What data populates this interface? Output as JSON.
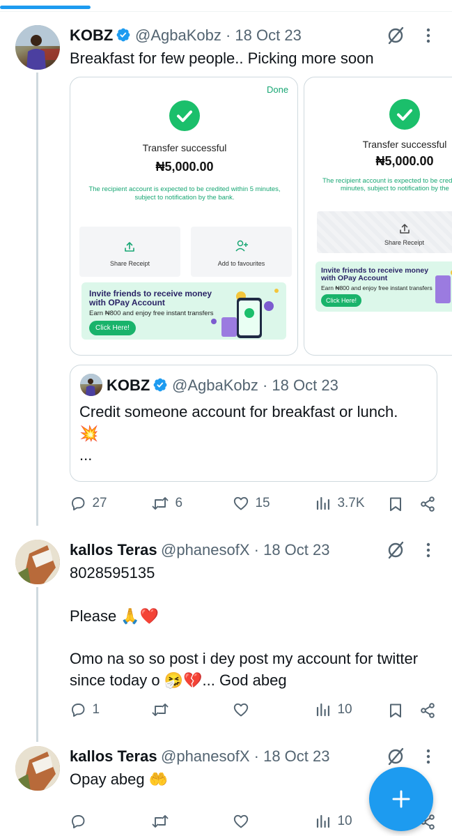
{
  "progress": {
    "fraction": 0.2
  },
  "tweet1": {
    "name": "KOBZ",
    "handle": "@AgbaKobz",
    "date": "· 18 Oct 23",
    "text": "Breakfast for few people.. Picking more soon",
    "receipt1": {
      "done_label": "Done",
      "status": "Transfer successful",
      "amount": "₦5,000.00",
      "note_line1": "The recipient account is expected to be credited within 5 minutes,",
      "note_line2": "subject to notification by the bank.",
      "share_label": "Share Receipt",
      "favourites_label": "Add to favourites",
      "promo_title_line1": "Invite friends to receive money",
      "promo_title_line2": "with OPay Account",
      "promo_sub": "Earn ₦800 and enjoy free instant transfers",
      "promo_button": "Click Here!"
    },
    "receipt2": {
      "status": "Transfer successful",
      "amount": "₦5,000.00",
      "note_line1": "The recipient account is expected to be credi",
      "note_line2": "minutes, subject to notification by the",
      "share_label": "Share Receipt",
      "promo_title_line1": "Invite friends to receive money",
      "promo_title_line2": "with OPay Account",
      "promo_sub": "Earn ₦800 and enjoy free instant transfers",
      "promo_button": "Click Here!"
    },
    "quote": {
      "name": "KOBZ",
      "handle": "@AgbaKobz",
      "date": "· 18 Oct 23",
      "line1": "Credit someone account for breakfast or lunch.",
      "line2": "💥",
      "line3": "..."
    },
    "actions": {
      "replies": "27",
      "reposts": "6",
      "likes": "15",
      "views": "3.7K"
    }
  },
  "tweet2": {
    "name": "kallos Teras",
    "handle": "@phanesofX",
    "date": "· 18 Oct 23",
    "line1": "8028595135",
    "line2": "Please 🙏❤️",
    "line3": "Omo na so so post i dey post my account for twitter",
    "line4": "since today o 🤧💔... God abeg",
    "actions": {
      "replies": "1",
      "reposts": "",
      "likes": "",
      "views": "10"
    }
  },
  "tweet3": {
    "name": "kallos Teras",
    "handle": "@phanesofX",
    "date": "· 18 Oct 23",
    "text": "Opay abeg 🤲",
    "actions": {
      "replies": "",
      "reposts": "",
      "likes": "",
      "views": "10"
    }
  },
  "colors": {
    "accent": "#1d9bf0",
    "opay_green": "#1bbf6b",
    "text_secondary": "#536471"
  },
  "icons": {
    "verified": "verified-badge-icon",
    "grok": "grok-icon",
    "more": "more-vertical-icon",
    "reply": "reply-icon",
    "repost": "repost-icon",
    "like": "heart-icon",
    "views": "views-icon",
    "bookmark": "bookmark-icon",
    "share": "share-icon",
    "compose": "plus-icon"
  }
}
